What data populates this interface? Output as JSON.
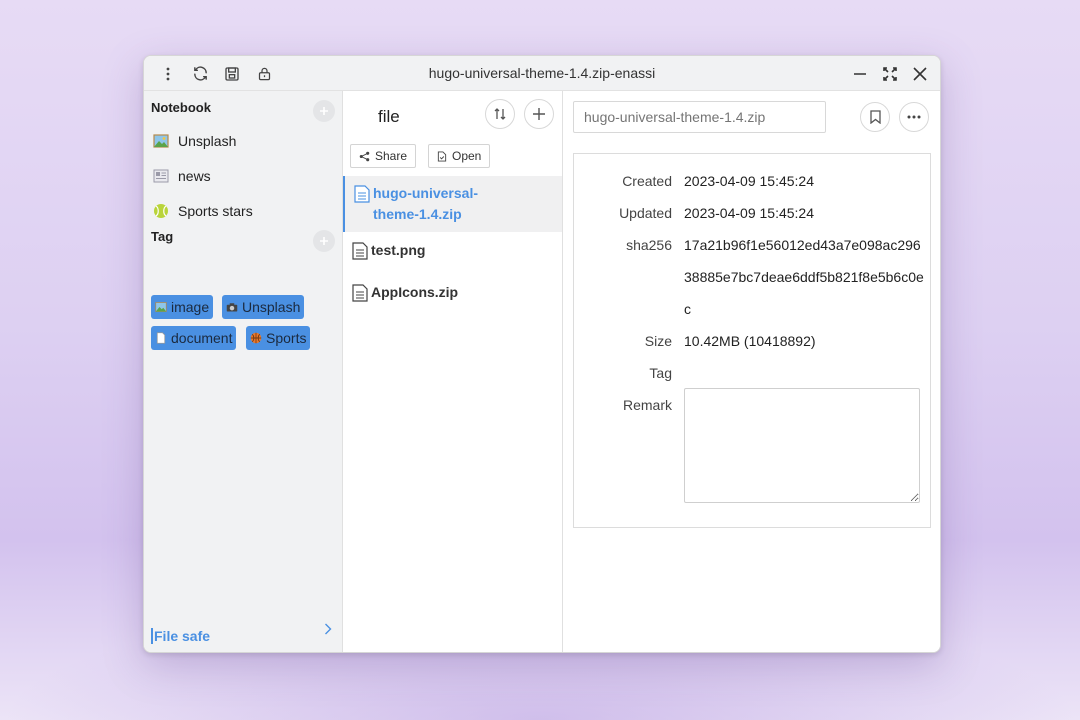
{
  "window": {
    "title": "hugo-universal-theme-1.4.zip-enassi"
  },
  "titlebar_icons": {
    "menu": "more-vertical-icon",
    "sync": "sync-icon",
    "save": "save-icon",
    "lock": "lock-icon",
    "minimize": "minimize-icon",
    "maximize": "maximize-icon",
    "close": "close-icon"
  },
  "sidebar": {
    "notebook_heading": "Notebook",
    "notebooks": [
      {
        "label": "Unsplash",
        "icon": "picture-icon"
      },
      {
        "label": "news",
        "icon": "newspaper-icon"
      },
      {
        "label": "Sports stars",
        "icon": "tennis-ball-icon"
      }
    ],
    "tag_heading": "Tag",
    "tags": [
      {
        "label": "image",
        "icon": "picture-icon"
      },
      {
        "label": "Unsplash",
        "icon": "camera-icon"
      },
      {
        "label": "document",
        "icon": "page-icon"
      },
      {
        "label": "Sports",
        "icon": "basketball-icon"
      }
    ],
    "file_safe_label": "File safe",
    "accent": "#4a90e2"
  },
  "filelist": {
    "title": "file",
    "share_label": "Share",
    "open_label": "Open",
    "files": [
      {
        "name_line1": "hugo-universal-",
        "name_line2": "theme-1.4.zip",
        "active": true
      },
      {
        "name_line1": "test.png",
        "name_line2": "",
        "active": false
      },
      {
        "name_line1": "AppIcons.zip",
        "name_line2": "",
        "active": false
      }
    ]
  },
  "detail": {
    "name_placeholder": "hugo-universal-theme-1.4.zip",
    "created_label": "Created",
    "created_value": "2023-04-09 15:45:24",
    "updated_label": "Updated",
    "updated_value": "2023-04-09 15:45:24",
    "sha_label": "sha256",
    "sha_line1": "17a21b96f1e56012ed43a7e098ac296",
    "sha_line2": "38885e7bc7deae6ddf5b821f8e5b6c0e",
    "sha_line3": "c",
    "size_label": "Size",
    "size_value": "10.42MB (10418892)",
    "tag_label": "Tag",
    "remark_label": "Remark"
  }
}
